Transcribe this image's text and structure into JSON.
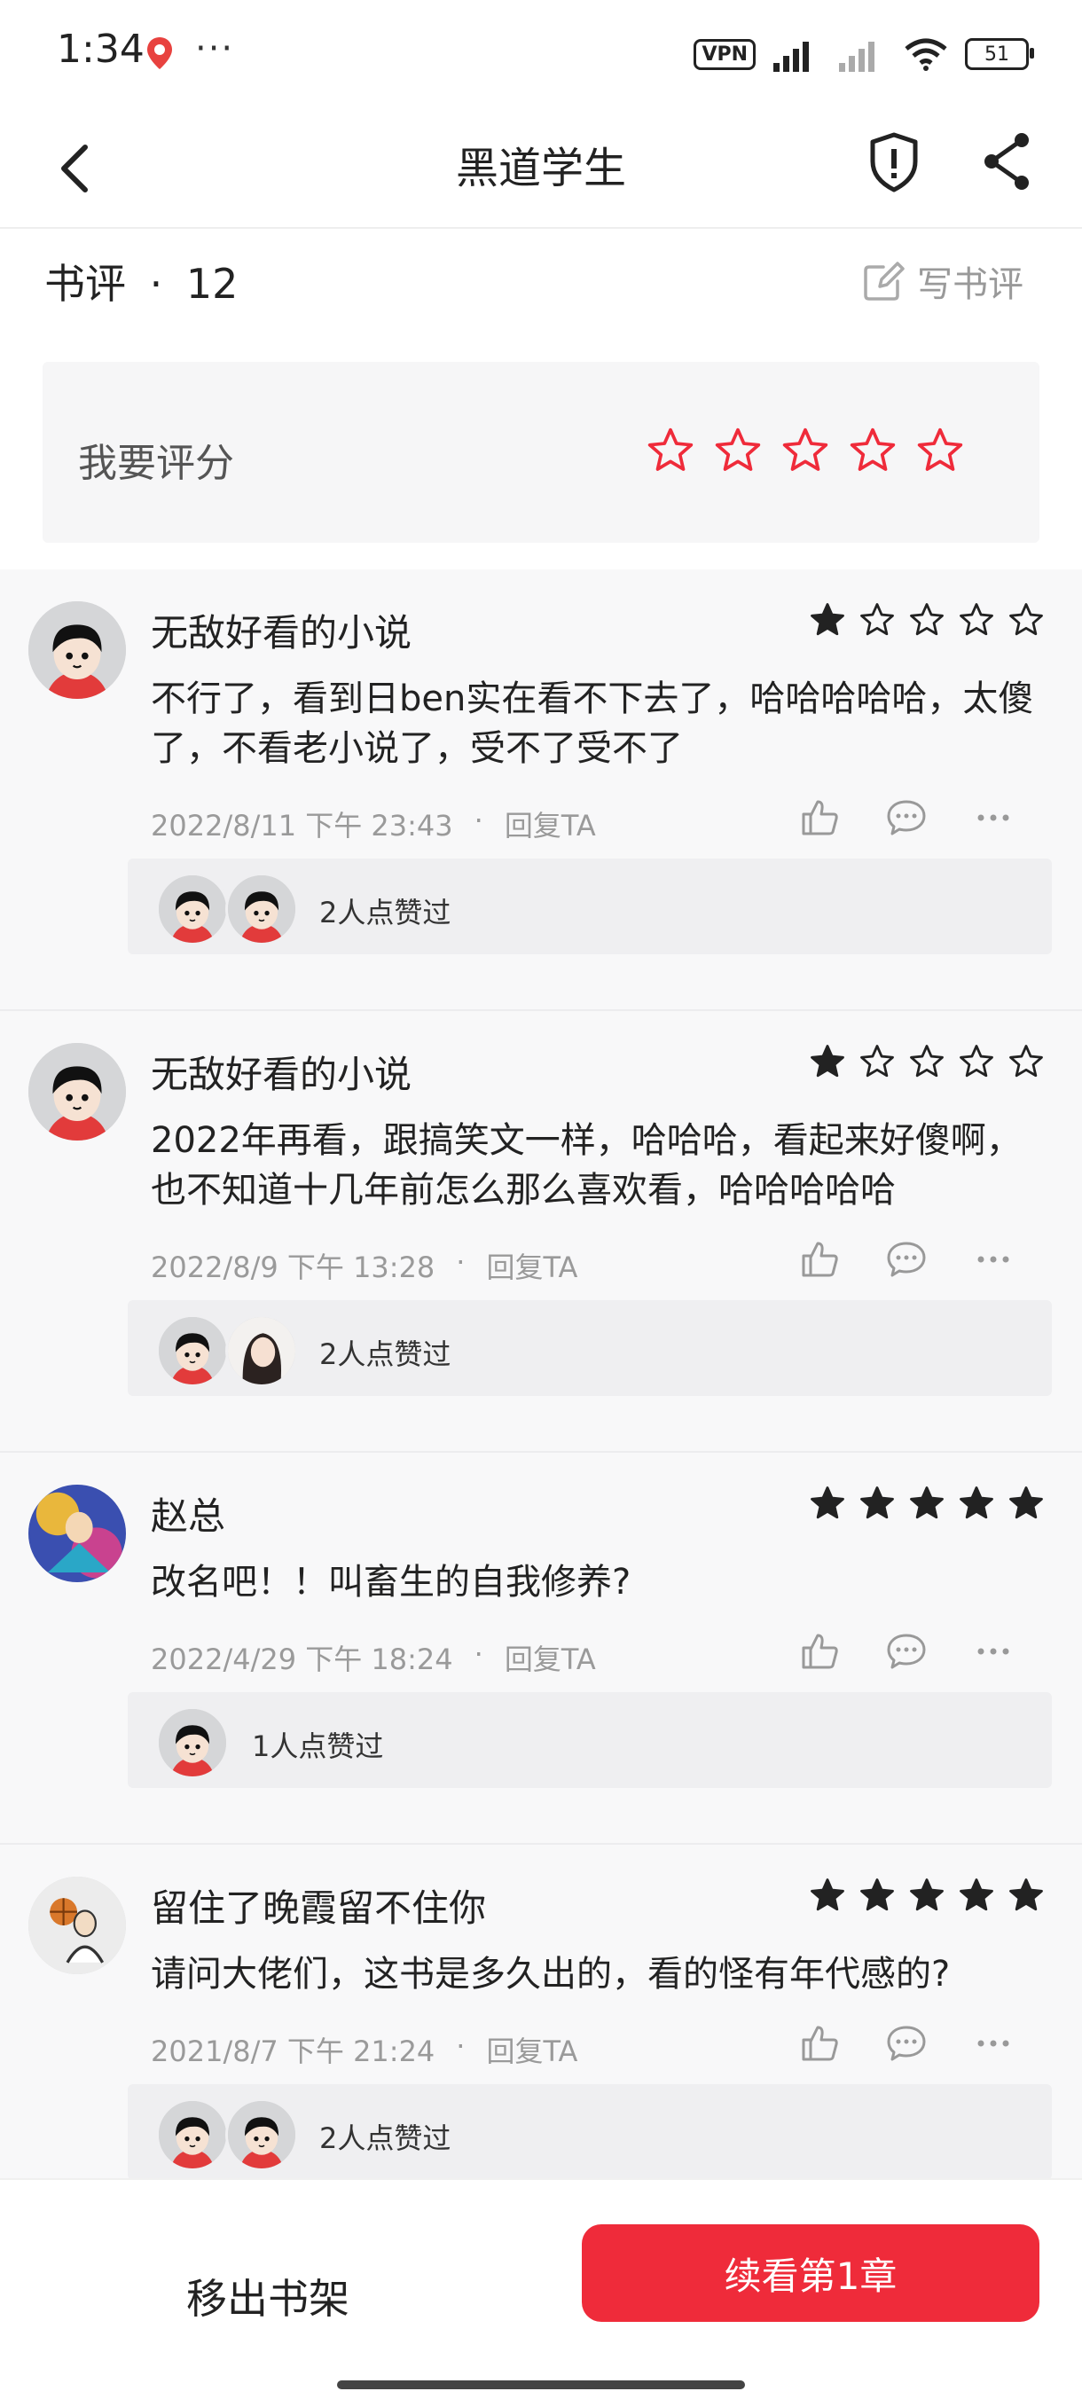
{
  "status_bar": {
    "time": "1:34",
    "more": "···",
    "vpn": "VPN",
    "battery": "51"
  },
  "nav": {
    "title": "黑道学生"
  },
  "reviews_header": {
    "label": "书评",
    "separator": "·",
    "count": "12",
    "write_label": "写书评"
  },
  "rating_box": {
    "label": "我要评分",
    "stars": 5
  },
  "reviews": [
    {
      "name": "无敌好看的小说",
      "rating": 1,
      "text": "不行了，看到日ben实在看不下去了，哈哈哈哈哈，太傻了，不看老小说了，受不了受不了",
      "date": "2022/8/11 下午 23:43",
      "dot": "·",
      "reply": "回复TA",
      "likes_text": "2人点赞过",
      "avatar_icon": "cartoon-boy-avatar"
    },
    {
      "name": "无敌好看的小说",
      "rating": 1,
      "text": "2022年再看，跟搞笑文一样，哈哈哈，看起来好傻啊，也不知道十几年前怎么那么喜欢看，哈哈哈哈哈",
      "date": "2022/8/9 下午 13:28",
      "dot": "·",
      "reply": "回复TA",
      "likes_text": "2人点赞过",
      "avatar_icon": "cartoon-boy-avatar"
    },
    {
      "name": "赵总",
      "rating": 5,
      "text": "改名吧！！叫畜生的自我修养?",
      "date": "2022/4/29 下午 18:24",
      "dot": "·",
      "reply": "回复TA",
      "likes_text": "1人点赞过",
      "avatar_icon": "game-character-avatar"
    },
    {
      "name": "留住了晚霞留不住你",
      "rating": 5,
      "text": "请问大佬们，这书是多久出的，看的怪有年代感的?",
      "date": "2021/8/7 下午 21:24",
      "dot": "·",
      "reply": "回复TA",
      "likes_text": "2人点赞过",
      "avatar_icon": "basketball-player-avatar"
    }
  ],
  "bottom": {
    "remove_label": "移出书架",
    "continue_label": "续看第1章"
  },
  "colors": {
    "accent": "#ef2b3a",
    "star_filled": "#222222"
  }
}
